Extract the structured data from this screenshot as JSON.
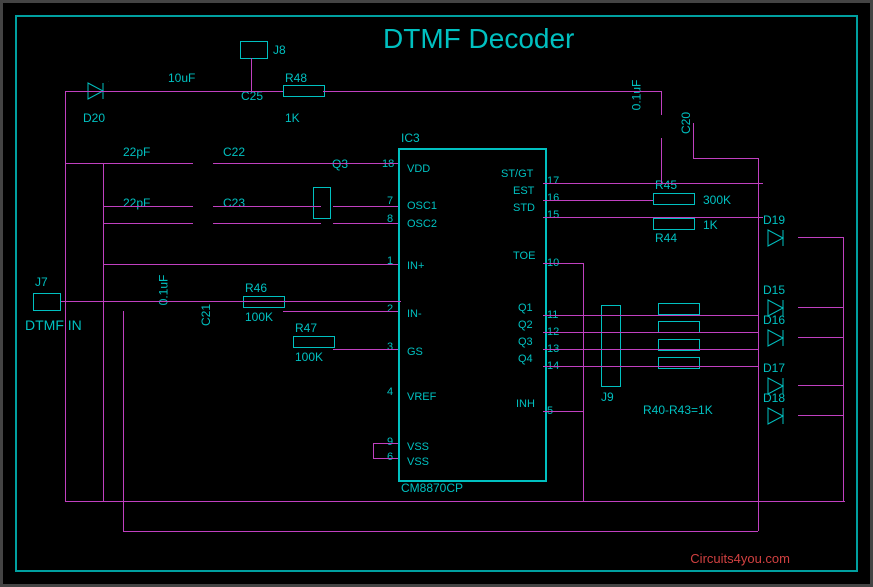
{
  "title": "DTMF Decoder",
  "credit": "Circuits4you.com",
  "connectors": {
    "j7": {
      "ref": "J7",
      "label": "DTMF IN"
    },
    "j8": {
      "ref": "J8"
    },
    "j9": {
      "ref": "J9"
    }
  },
  "ic": {
    "ref": "IC3",
    "part": "CM8870CP",
    "pins_left": [
      {
        "num": "18",
        "name": "VDD"
      },
      {
        "num": "7",
        "name": "OSC1"
      },
      {
        "num": "8",
        "name": "OSC2"
      },
      {
        "num": "1",
        "name": "IN+"
      },
      {
        "num": "2",
        "name": "IN-"
      },
      {
        "num": "3",
        "name": "GS"
      },
      {
        "num": "4",
        "name": "VREF"
      },
      {
        "num": "9",
        "name": "VSS"
      },
      {
        "num": "6",
        "name": "VSS"
      }
    ],
    "pins_right": [
      {
        "num": "17",
        "name": "ST/GT"
      },
      {
        "num": "16",
        "name": "EST"
      },
      {
        "num": "15",
        "name": "STD"
      },
      {
        "num": "10",
        "name": "TOE"
      },
      {
        "num": "11",
        "name": "Q1"
      },
      {
        "num": "12",
        "name": "Q2"
      },
      {
        "num": "13",
        "name": "Q3"
      },
      {
        "num": "14",
        "name": "Q4"
      },
      {
        "num": "5",
        "name": "INH"
      }
    ]
  },
  "components": {
    "d20": {
      "ref": "D20"
    },
    "d19": {
      "ref": "D19"
    },
    "d15": {
      "ref": "D15"
    },
    "d16": {
      "ref": "D16"
    },
    "d17": {
      "ref": "D17"
    },
    "d18": {
      "ref": "D18"
    },
    "q3": {
      "ref": "Q3"
    },
    "c20": {
      "ref": "C20",
      "val": "0.1uF"
    },
    "c21": {
      "ref": "C21",
      "val": "0.1uF"
    },
    "c22": {
      "ref": "C22",
      "val": "22pF"
    },
    "c23": {
      "ref": "C23",
      "val": "22pF"
    },
    "c25": {
      "ref": "C25",
      "val": "10uF"
    },
    "r44": {
      "ref": "R44",
      "val": "1K"
    },
    "r45": {
      "ref": "R45",
      "val": "300K"
    },
    "r46": {
      "ref": "R46",
      "val": "100K"
    },
    "r47": {
      "ref": "R47",
      "val": "100K"
    },
    "r48": {
      "ref": "R48",
      "val": "1K"
    },
    "rgroup": {
      "ref": "R40-R43=1K"
    }
  }
}
